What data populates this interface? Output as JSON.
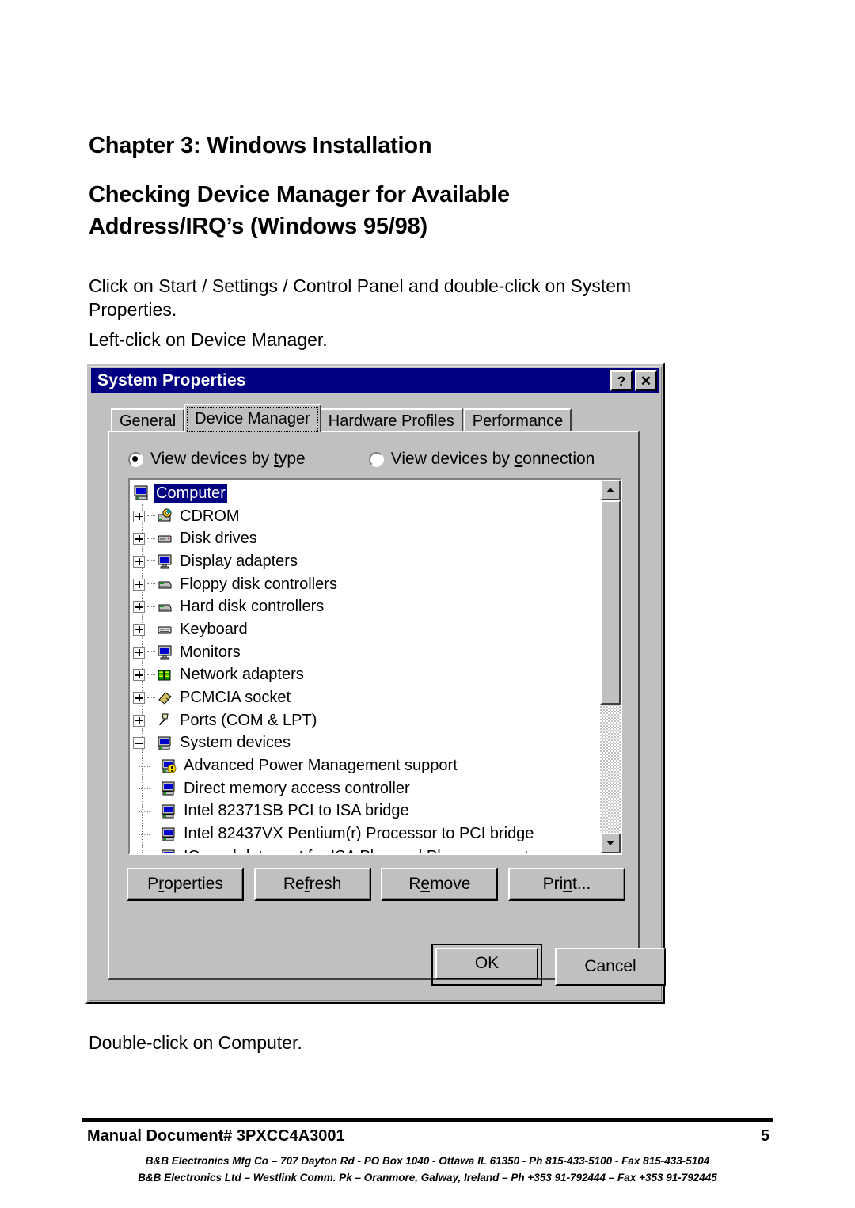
{
  "document": {
    "chapter_heading": "Chapter 3:  Windows Installation",
    "section_heading": "Checking Device Manager for Available Address/IRQ’s (Windows 95/98)",
    "paragraph_1": "Click on Start / Settings / Control Panel and double-click on System Properties.",
    "paragraph_2": "Left-click on Device Manager.",
    "paragraph_3": "Double-click on Computer."
  },
  "footer": {
    "manual_doc": "Manual Document# 3PXCC4A3001",
    "page_number": "5",
    "address_line_1": "B&B Electronics Mfg Co – 707 Dayton Rd - PO Box 1040 - Ottawa IL 61350 - Ph 815-433-5100 - Fax 815-433-5104",
    "address_line_2": "B&B Electronics Ltd – Westlink Comm. Pk – Oranmore, Galway, Ireland – Ph +353 91-792444 – Fax +353 91-792445"
  },
  "dialog": {
    "title": "System Properties",
    "titlebar_color": "#000080",
    "face_color": "#c0c0c0",
    "help_button": "?",
    "close_button": "✕",
    "tabs": [
      {
        "label": "General",
        "active": false
      },
      {
        "label": "Device Manager",
        "active": true
      },
      {
        "label": "Hardware Profiles",
        "active": false
      },
      {
        "label": "Performance",
        "active": false
      }
    ],
    "view_options": [
      {
        "label_before": "View devices by ",
        "accel": "t",
        "label_after": "ype",
        "selected": true
      },
      {
        "label_before": "View devices by ",
        "accel": "c",
        "label_after": "onnection",
        "selected": false
      }
    ],
    "tree": {
      "selection": "Computer",
      "selection_color": "#000080",
      "items": [
        {
          "label": "Computer",
          "icon": "computer-icon",
          "expander": "none",
          "level": 0,
          "selected": true
        },
        {
          "label": "CDROM",
          "icon": "cdrom-icon",
          "expander": "plus",
          "level": 0,
          "selected": false
        },
        {
          "label": "Disk drives",
          "icon": "disk-drive-icon",
          "expander": "plus",
          "level": 0,
          "selected": false
        },
        {
          "label": "Display adapters",
          "icon": "display-adapter-icon",
          "expander": "plus",
          "level": 0,
          "selected": false
        },
        {
          "label": "Floppy disk controllers",
          "icon": "floppy-controller-icon",
          "expander": "plus",
          "level": 0,
          "selected": false
        },
        {
          "label": "Hard disk controllers",
          "icon": "hard-disk-controller-icon",
          "expander": "plus",
          "level": 0,
          "selected": false
        },
        {
          "label": "Keyboard",
          "icon": "keyboard-icon",
          "expander": "plus",
          "level": 0,
          "selected": false
        },
        {
          "label": "Monitors",
          "icon": "monitor-icon",
          "expander": "plus",
          "level": 0,
          "selected": false
        },
        {
          "label": "Network adapters",
          "icon": "network-adapter-icon",
          "expander": "plus",
          "level": 0,
          "selected": false
        },
        {
          "label": "PCMCIA socket",
          "icon": "pcmcia-icon",
          "expander": "plus",
          "level": 0,
          "selected": false
        },
        {
          "label": "Ports (COM & LPT)",
          "icon": "port-icon",
          "expander": "plus",
          "level": 0,
          "selected": false
        },
        {
          "label": "System devices",
          "icon": "system-device-icon",
          "expander": "minus",
          "level": 0,
          "selected": false
        },
        {
          "label": "Advanced Power Management support",
          "icon": "system-device-warning-icon",
          "expander": "none",
          "level": 1,
          "selected": false
        },
        {
          "label": "Direct memory access controller",
          "icon": "system-device-icon",
          "expander": "none",
          "level": 1,
          "selected": false
        },
        {
          "label": "Intel 82371SB PCI to ISA bridge",
          "icon": "system-device-icon",
          "expander": "none",
          "level": 1,
          "selected": false
        },
        {
          "label": "Intel 82437VX Pentium(r) Processor to PCI bridge",
          "icon": "system-device-icon",
          "expander": "none",
          "level": 1,
          "selected": false
        },
        {
          "label": "IO read data port for ISA Plug and Play enumerator",
          "icon": "system-device-icon",
          "expander": "none",
          "level": 1,
          "selected": false
        }
      ]
    },
    "scrollbar": {
      "up_arrow": "▲",
      "down_arrow": "▼"
    },
    "action_buttons": [
      {
        "before": "P",
        "accel": "r",
        "after": "operties"
      },
      {
        "before": "Re",
        "accel": "f",
        "after": "resh"
      },
      {
        "before": "R",
        "accel": "e",
        "after": "move"
      },
      {
        "before": "Pri",
        "accel": "n",
        "after": "t..."
      }
    ],
    "ok_label": "OK",
    "cancel_label": "Cancel"
  }
}
